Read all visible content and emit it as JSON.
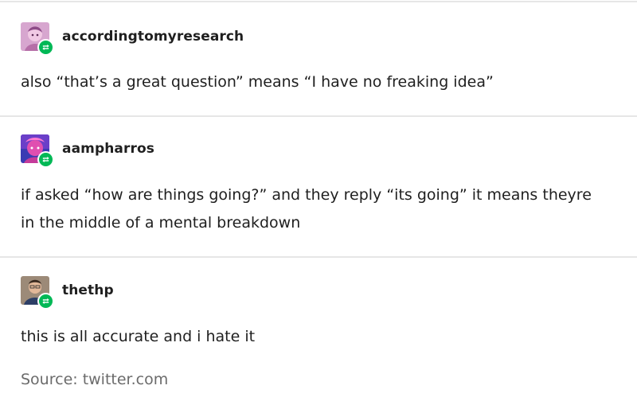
{
  "posts": [
    {
      "username": "accordingtomyresearch",
      "text": "also “that’s a great question” means “I have no freaking idea”",
      "avatar_icon": "pink-anime-avatar"
    },
    {
      "username": "aampharros",
      "text": "if asked “how are things going?” and they reply “its going” it means theyre in the middle of a mental breakdown",
      "avatar_icon": "magenta-anime-avatar"
    },
    {
      "username": "thethp",
      "text": "this is all accurate and i hate it",
      "avatar_icon": "photo-avatar"
    }
  ],
  "source_text": "Source: twitter.com",
  "colors": {
    "reblog_badge": "#00b856",
    "divider": "#e6e6e6",
    "text": "#1f1f1f",
    "muted_text": "#6b6b6b"
  }
}
